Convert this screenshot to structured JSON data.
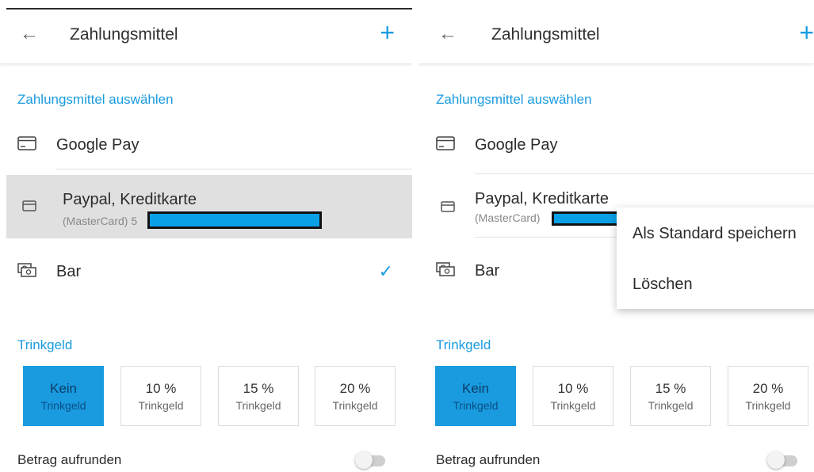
{
  "header": {
    "title": "Zahlungsmittel",
    "back_icon": "arrow-left-icon",
    "add_icon": "plus-icon"
  },
  "section_payment": "Zahlungsmittel auswählen",
  "payment_methods": [
    {
      "title": "Google Pay",
      "icon": "card-icon"
    },
    {
      "title": "Paypal, Kreditkarte",
      "subtitle_left": "(MasterCard) 5",
      "subtitle_right": "(MasterCard)",
      "icon": "card-icon"
    },
    {
      "title": "Bar",
      "icon": "cash-icon",
      "selected": true
    }
  ],
  "section_tip": "Trinkgeld",
  "tips": [
    {
      "value": "Kein",
      "label": "Trinkgeld",
      "selected": true
    },
    {
      "value": "10 %",
      "label": "Trinkgeld"
    },
    {
      "value": "15 %",
      "label": "Trinkgeld"
    },
    {
      "value": "20 %",
      "label": "Trinkgeld"
    }
  ],
  "round_up": {
    "label": "Betrag aufrunden",
    "enabled": false
  },
  "context_menu": {
    "set_default": "Als Standard speichern",
    "delete": "Löschen"
  },
  "colors": {
    "accent": "#1a9be0",
    "highlight_row": "#e0e0e0",
    "redaction": "#0aa0e6"
  }
}
